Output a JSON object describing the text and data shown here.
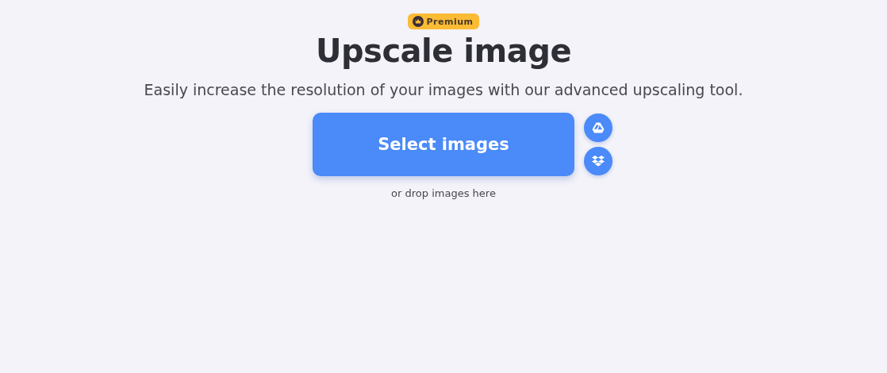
{
  "badge": "Premium",
  "title": "Upscale image",
  "subtitle": "Easily increase the resolution of your images with our advanced upscaling tool.",
  "button": "Select images",
  "hint": "or drop images here"
}
